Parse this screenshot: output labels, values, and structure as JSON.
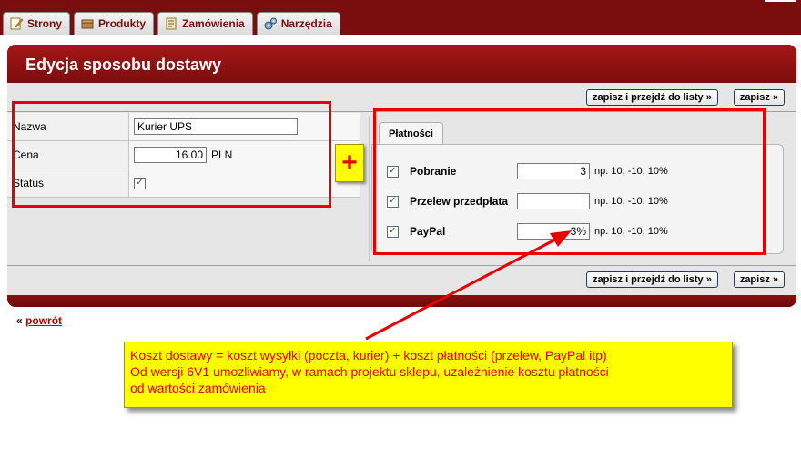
{
  "nav": {
    "tabs": [
      {
        "label": "Strony",
        "icon": "pencil-page-icon"
      },
      {
        "label": "Produkty",
        "icon": "box-icon"
      },
      {
        "label": "Zamówienia",
        "icon": "cart-icon"
      },
      {
        "label": "Narzędzia",
        "icon": "gears-icon"
      }
    ]
  },
  "page": {
    "title": "Edycja sposobu dostawy",
    "save_and_list_label": "zapisz i przejdź do listy »",
    "save_label": "zapisz »",
    "back_prefix": "«",
    "back_link": "powrót"
  },
  "form": {
    "name_label": "Nazwa",
    "name_value": "Kurier UPS",
    "price_label": "Cena",
    "price_value": "16.00",
    "currency": "PLN",
    "status_label": "Status",
    "status_checked": true
  },
  "payments": {
    "tab_label": "Płatności",
    "hint": "np. 10, -10, 10%",
    "items": [
      {
        "label": "Pobranie",
        "value": "3",
        "checked": true
      },
      {
        "label": "Przelew przedpłata",
        "value": "",
        "checked": true
      },
      {
        "label": "PayPal",
        "value": "3%",
        "checked": true
      }
    ]
  },
  "annotation": {
    "plus": "+",
    "lines": [
      "Koszt dostawy = koszt wysyłki (poczta, kurier) + koszt płatności (przelew, PayPal itp)",
      "Od wersji 6V1 umozliwiamy, w ramach projektu sklepu, uzależnienie kosztu płatności",
      "od wartości zamówienia"
    ]
  },
  "colors": {
    "brand": "#8e1212",
    "highlight_red": "#e80000",
    "note_yellow": "#ffff00"
  }
}
